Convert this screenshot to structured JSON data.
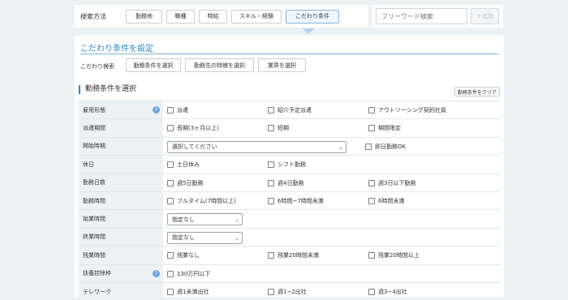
{
  "search_method": {
    "label": "検索方法",
    "tabs": [
      "勤務地",
      "職種",
      "時給",
      "スキル・経験",
      "こだわり条件"
    ],
    "active_tab": "こだわり条件"
  },
  "freeword": {
    "placeholder": "フリーワード検索",
    "add_label": "＋追加"
  },
  "panel": {
    "title": "こだわり条件を設定",
    "kodawari_label": "こだわり検索",
    "buttons": [
      "勤務条件を選択",
      "勤務先の特徴を選択",
      "業界を選択"
    ]
  },
  "section": {
    "title": "勤務条件を選択",
    "clear_label": "勤務条件をクリア"
  },
  "rows": [
    {
      "label": "雇用形態",
      "help": "?",
      "options": [
        "派遣",
        "紹介予定派遣",
        "アウトソーシング契約社員"
      ]
    },
    {
      "label": "派遣期間",
      "options": [
        "長期(3ヶ月以上)",
        "短期",
        "期間限定"
      ]
    },
    {
      "label": "開始時期",
      "select": "選択してください",
      "options": [
        "即日勤務OK"
      ]
    },
    {
      "label": "休日",
      "options": [
        "土日休み",
        "シフト勤務"
      ]
    },
    {
      "label": "勤務日数",
      "options": [
        "週5日勤務",
        "週4日勤務",
        "週3日以下勤務"
      ]
    },
    {
      "label": "勤務時間",
      "options": [
        "フルタイム(7時間以上)",
        "6時間~7時間未満",
        "6時間未満"
      ]
    },
    {
      "label": "始業時間",
      "select": "指定なし"
    },
    {
      "label": "終業時間",
      "select": "指定なし"
    },
    {
      "label": "残業時間",
      "options": [
        "残業なし",
        "残業20時間未満",
        "残業20時間以上"
      ]
    },
    {
      "label": "扶養控除枠",
      "help": "?",
      "options": [
        "130万円以下"
      ]
    },
    {
      "label": "テレワーク",
      "options": [
        "週1未満出社",
        "週1~2出社",
        "週3~4出社"
      ]
    }
  ],
  "icons": {
    "help": "help-circle-icon",
    "select_arrow": "chevron-down-icon",
    "pointer": "caret-down-icon"
  },
  "colors": {
    "accent": "#2b86c5",
    "help": "#6fa8dc"
  }
}
